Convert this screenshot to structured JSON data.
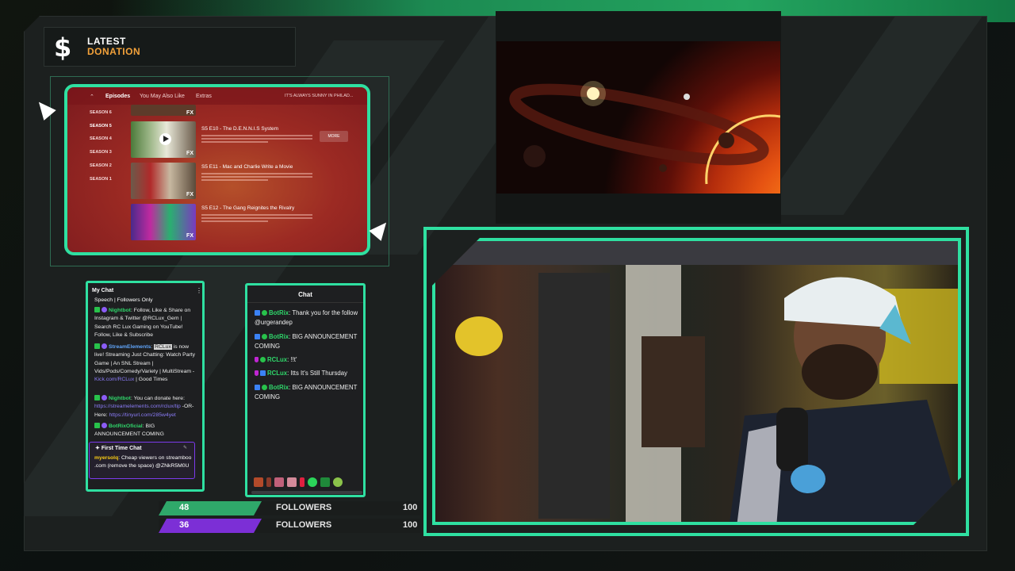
{
  "donation": {
    "line1": "LATEST",
    "line2": "DONATION",
    "icon": "dollar-icon"
  },
  "browser": {
    "tabs": [
      "Episodes",
      "You May Also Like",
      "Extras"
    ],
    "show_title": "IT'S ALWAYS SUNNY IN PHILAD...",
    "seasons": [
      "SEASON 6",
      "SEASON 5",
      "SEASON 4",
      "SEASON 3",
      "SEASON 2",
      "SEASON 1"
    ],
    "episodes": [
      {
        "title": "S5 E10 - The D.E.N.N.I.S System",
        "network": "FX"
      },
      {
        "title": "S5 E11 - Mac and Charlie Write a Movie",
        "network": "FX"
      },
      {
        "title": "S5 E12 - The Gang Reignites the Rivalry",
        "network": "FX"
      }
    ],
    "more_label": "MORE",
    "top_network": "FX"
  },
  "chat1": {
    "title": "My Chat",
    "subtitle": "Speech | Followers Only",
    "messages": [
      {
        "name": "Nightbot",
        "text": ": Follow, Like & Share on Instagram & Twitter @RCLux_Gem | Search RC Lux Gaming on YouTube! Follow, Like & Subscribe"
      },
      {
        "name": "StreamElements",
        "text_a": ": ",
        "highlight": "RCLux",
        "text_b": " is now live! Streaming Just Chatting: Watch Party Game | An SNL Stream | Vids/Pods/Comedy/Variety | MultiStream - ",
        "link": "Kick.com/RCLux",
        "text_c": " | Good Times"
      },
      {
        "name": "Nightbot",
        "text": ": You can donate here: ",
        "link1": "https://streamelements.com/rclux/tip",
        "text2": " -OR- Here: ",
        "link2": "https://tinyurl.com/285w4yet"
      },
      {
        "name": "BotRixOficial",
        "text": ": BIG ANNOUNCEMENT COMING"
      }
    ],
    "first_time": {
      "title": "First Time Chat",
      "name": "myersolq",
      "text": ": Cheap viewers on streamboo .com (remove the space) @ZNkR5M0U"
    }
  },
  "chat2": {
    "title": "Chat",
    "messages": [
      {
        "name": "BotRix",
        "text": ": Thank you for the follow @urgerandep"
      },
      {
        "name": "BotRix",
        "text": ": BIG ANNOUNCEMENT COMING"
      },
      {
        "name": "RCLux",
        "text": ": !!t'"
      },
      {
        "name": "RCLux",
        "text": ": Itts It's Still Thursday"
      },
      {
        "name": "BotRix",
        "text": ": BIG ANNOUNCEMENT COMING"
      }
    ]
  },
  "followers": [
    {
      "count": "48",
      "label": "FOLLOWERS",
      "goal": "100",
      "color": "#2fa86a",
      "progress": 0.48
    },
    {
      "count": "36",
      "label": "FOLLOWERS",
      "goal": "100",
      "color": "#7c2fd6",
      "progress": 0.36
    }
  ],
  "colors": {
    "accent": "#2fe0a1",
    "donation": "#f2a13a",
    "browser_bg": "#9c2a23"
  }
}
